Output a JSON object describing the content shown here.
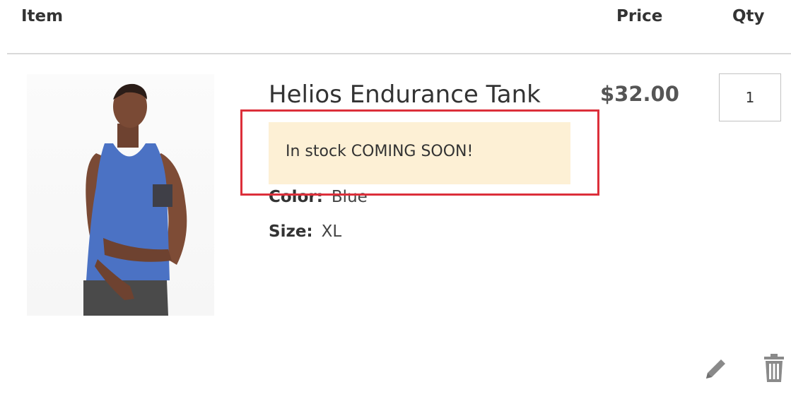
{
  "table": {
    "headers": {
      "item": "Item",
      "price": "Price",
      "qty": "Qty"
    }
  },
  "cart_item": {
    "name": "Helios Endurance Tank",
    "price": "$32.00",
    "qty": "1",
    "stock_notice": "In stock COMING SOON!",
    "options": {
      "color": {
        "label": "Color:",
        "value": "Blue"
      },
      "size": {
        "label": "Size:",
        "value": "XL"
      }
    }
  },
  "icons": {
    "edit": "pencil-icon",
    "delete": "trash-icon"
  },
  "colors": {
    "notice_background": "#fdf0d5",
    "highlight_border": "#dc2f3a",
    "icon_gray": "#8a8a8a"
  }
}
